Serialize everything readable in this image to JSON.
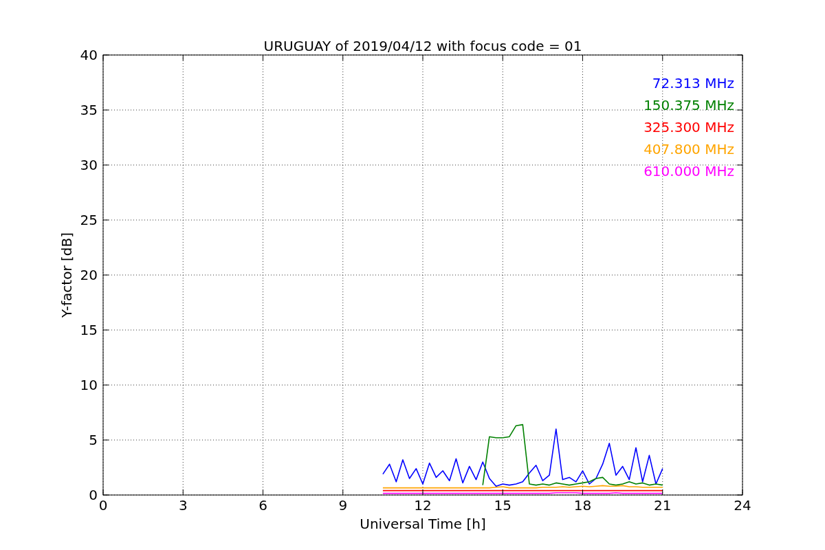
{
  "chart_data": {
    "type": "line",
    "title": "URUGUAY of 2019/04/12 with focus code = 01",
    "xlabel": "Universal Time [h]",
    "ylabel": "Y-factor [dB]",
    "x": [
      10.5,
      10.75,
      11,
      11.25,
      11.5,
      11.75,
      12,
      12.25,
      12.5,
      12.75,
      13,
      13.25,
      13.5,
      13.75,
      14,
      14.25,
      14.5,
      14.75,
      15,
      15.25,
      15.5,
      15.75,
      16,
      16.25,
      16.5,
      16.75,
      17,
      17.25,
      17.5,
      17.75,
      18,
      18.25,
      18.5,
      18.75,
      19,
      19.25,
      19.5,
      19.75,
      20,
      20.25,
      20.5,
      20.75,
      21
    ],
    "series": [
      {
        "name": "72.313 MHz",
        "color": "#0000ff",
        "values": [
          1.9,
          2.8,
          1.2,
          3.2,
          1.5,
          2.4,
          1.0,
          2.9,
          1.6,
          2.2,
          1.3,
          3.3,
          1.1,
          2.6,
          1.4,
          3.0,
          1.5,
          0.8,
          1.0,
          0.9,
          1.0,
          1.2,
          2.0,
          2.7,
          1.3,
          1.8,
          6.0,
          1.4,
          1.6,
          1.2,
          2.2,
          1.0,
          1.5,
          2.8,
          4.7,
          1.8,
          2.6,
          1.4,
          4.3,
          1.2,
          3.6,
          1.0,
          2.4
        ]
      },
      {
        "name": "150.375 MHz",
        "color": "#008000",
        "values": [
          null,
          null,
          null,
          null,
          null,
          null,
          null,
          null,
          null,
          null,
          null,
          null,
          null,
          null,
          null,
          0.9,
          5.3,
          5.2,
          5.2,
          5.3,
          6.3,
          6.4,
          1.0,
          0.9,
          1.0,
          0.9,
          1.1,
          1.0,
          0.9,
          1.0,
          1.1,
          1.2,
          1.5,
          1.6,
          1.0,
          0.9,
          1.0,
          1.2,
          1.0,
          1.1,
          0.9,
          1.0,
          0.9
        ]
      },
      {
        "name": "325.300 MHz",
        "color": "#ff0000",
        "values": [
          0.4,
          0.4,
          0.4,
          0.4,
          0.4,
          0.4,
          0.4,
          0.4,
          0.4,
          0.4,
          0.4,
          0.4,
          0.4,
          0.4,
          0.4,
          0.4,
          0.4,
          0.4,
          0.4,
          0.4,
          0.4,
          0.4,
          0.4,
          0.4,
          0.4,
          0.4,
          0.4,
          0.4,
          0.4,
          0.4,
          0.4,
          0.4,
          0.4,
          0.4,
          0.4,
          0.4,
          0.4,
          0.4,
          0.4,
          0.4,
          0.4,
          0.4,
          0.4
        ]
      },
      {
        "name": "407.800 MHz",
        "color": "#ffa500",
        "values": [
          0.65,
          0.65,
          0.65,
          0.65,
          0.65,
          0.65,
          0.65,
          0.65,
          0.65,
          0.65,
          0.65,
          0.65,
          0.65,
          0.65,
          0.65,
          0.65,
          0.65,
          0.7,
          0.75,
          0.65,
          0.65,
          0.65,
          0.65,
          0.65,
          0.7,
          0.7,
          0.7,
          0.75,
          0.7,
          0.75,
          0.8,
          0.75,
          0.8,
          0.85,
          0.8,
          0.8,
          0.85,
          0.75,
          0.75,
          0.7,
          0.7,
          0.7,
          0.7
        ]
      },
      {
        "name": "610.000 MHz",
        "color": "#ff00ff",
        "values": [
          0.15,
          0.15,
          0.15,
          0.15,
          0.15,
          0.15,
          0.15,
          0.15,
          0.15,
          0.15,
          0.15,
          0.15,
          0.15,
          0.15,
          0.15,
          0.15,
          0.15,
          0.15,
          0.15,
          0.15,
          0.15,
          0.15,
          0.15,
          0.15,
          0.15,
          0.15,
          0.2,
          0.2,
          0.2,
          0.2,
          0.15,
          0.15,
          0.15,
          0.15,
          0.15,
          0.2,
          0.15,
          0.15,
          0.15,
          0.15,
          0.15,
          0.15,
          0.15
        ]
      }
    ],
    "grid": true,
    "xlim": [
      0,
      24
    ],
    "ylim": [
      0,
      40
    ],
    "xticks": [
      0,
      3,
      6,
      9,
      12,
      15,
      18,
      21,
      24
    ],
    "yticks": [
      0,
      5,
      10,
      15,
      20,
      25,
      30,
      35,
      40
    ]
  }
}
